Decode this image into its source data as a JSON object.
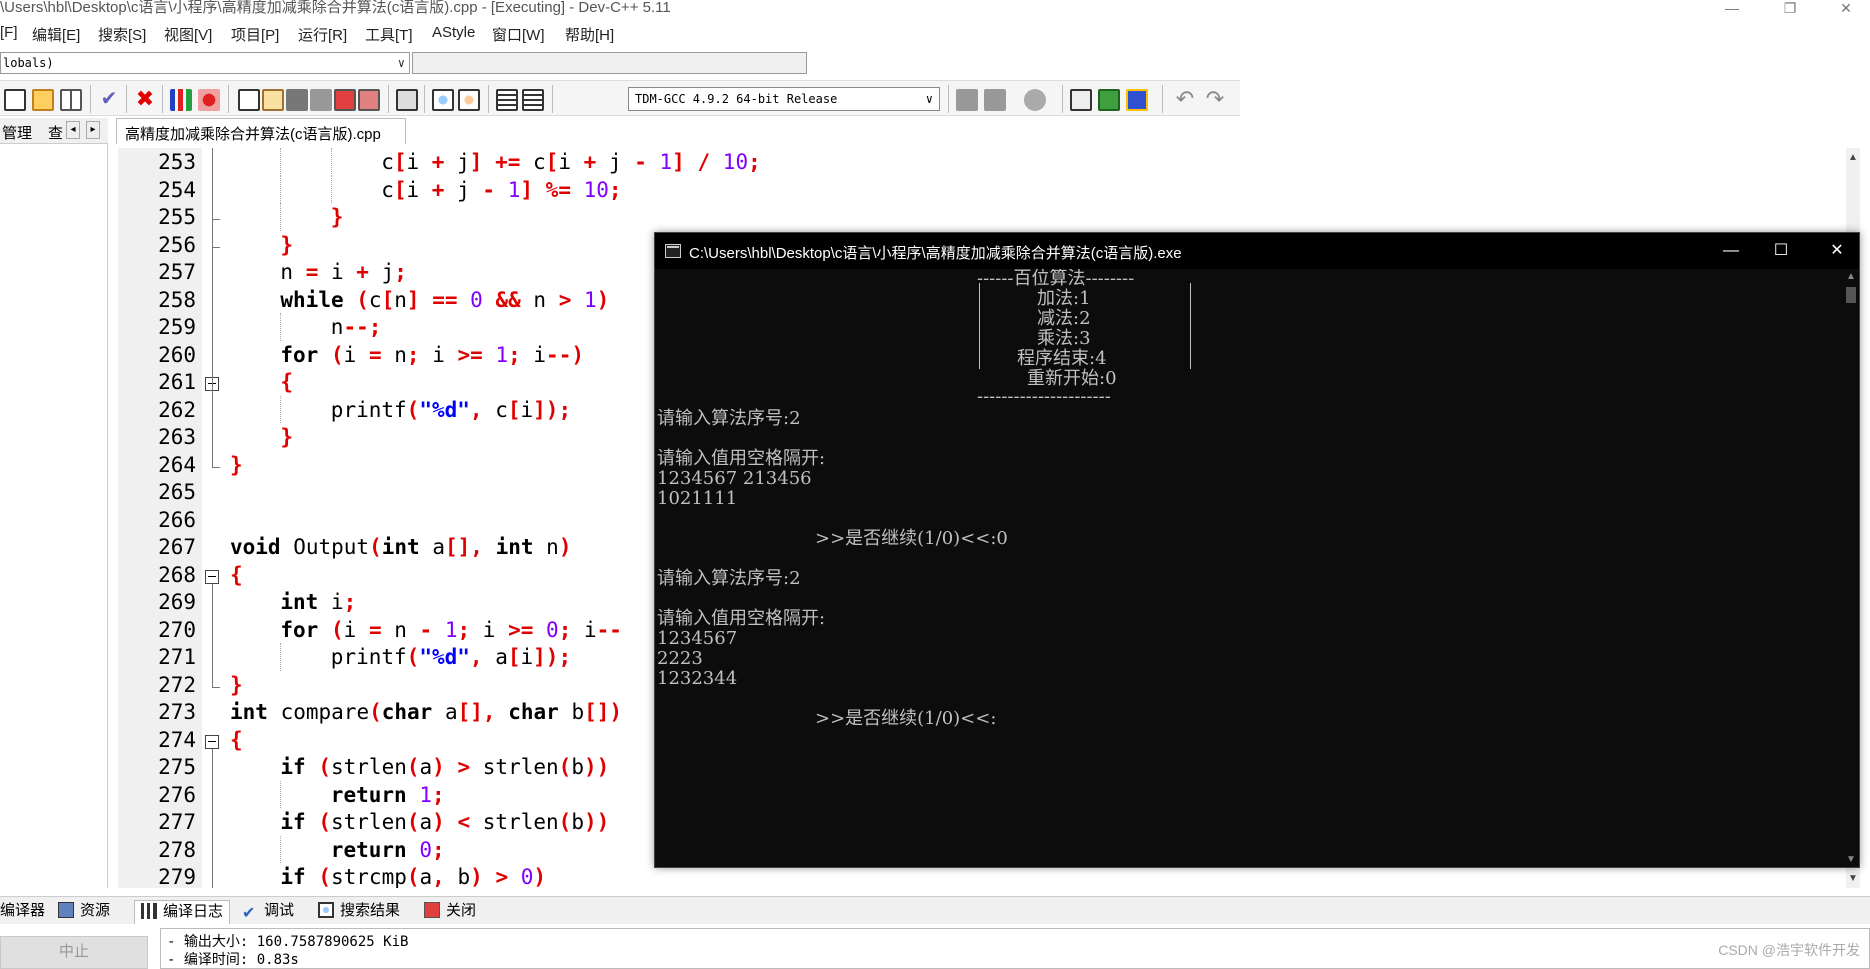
{
  "window": {
    "title": "\\Users\\hbl\\Desktop\\c语言\\小程序\\高精度加减乘除合并算法(c语言版).cpp - [Executing] - Dev-C++ 5.11",
    "minimize": "—",
    "restore": "❐",
    "close": "✕"
  },
  "menu": [
    "[F]",
    "编辑[E]",
    "搜索[S]",
    "视图[V]",
    "项目[P]",
    "运行[R]",
    "工具[T]",
    "AStyle",
    "窗口[W]",
    "帮助[H]"
  ],
  "scope": {
    "value": "lobals)",
    "arrow": "∨"
  },
  "toolbar": {
    "compiler": "TDM-GCC 4.9.2 64-bit Release",
    "arrow": "∨",
    "icons": [
      "new-file-icon",
      "open-file-icon",
      "grid-icon",
      "check-icon",
      "cross-icon",
      "chart-icon",
      "debug-icon",
      "page-icon",
      "edit-icon",
      "save-icon",
      "save-all-icon",
      "close-file-icon",
      "close-all-icon",
      "print-icon",
      "find-icon",
      "replace-icon",
      "indent-icon",
      "unindent-icon",
      "back-icon",
      "forward-icon",
      "bookmark-icon",
      "goto-icon",
      "add-icon",
      "toggle-icon",
      "undo-icon",
      "redo-icon"
    ]
  },
  "left_panel": {
    "tab1": "管理",
    "tab2": "查",
    "prev": "◂",
    "next": "▸"
  },
  "file_tab": "高精度加减乘除合并算法(c语言版).cpp",
  "editor": {
    "lines": [
      {
        "n": "253",
        "indent": 3,
        "code": [
          [
            "t",
            "c"
          ],
          [
            "s",
            "["
          ],
          [
            "t",
            "i "
          ],
          [
            "s",
            "+"
          ],
          [
            "t",
            " j"
          ],
          [
            "s",
            "]"
          ],
          [
            "t",
            " "
          ],
          [
            "s",
            "+="
          ],
          [
            "t",
            " c"
          ],
          [
            "s",
            "["
          ],
          [
            "t",
            "i "
          ],
          [
            "s",
            "+"
          ],
          [
            "t",
            " j "
          ],
          [
            "s",
            "-"
          ],
          [
            "t",
            " "
          ],
          [
            "n",
            "1"
          ],
          [
            "s",
            "]"
          ],
          [
            "t",
            " "
          ],
          [
            "s",
            "/"
          ],
          [
            "t",
            " "
          ],
          [
            "n",
            "10"
          ],
          [
            "s",
            ";"
          ]
        ]
      },
      {
        "n": "254",
        "indent": 3,
        "code": [
          [
            "t",
            "c"
          ],
          [
            "s",
            "["
          ],
          [
            "t",
            "i "
          ],
          [
            "s",
            "+"
          ],
          [
            "t",
            " j "
          ],
          [
            "s",
            "-"
          ],
          [
            "t",
            " "
          ],
          [
            "n",
            "1"
          ],
          [
            "s",
            "]"
          ],
          [
            "t",
            " "
          ],
          [
            "s",
            "%="
          ],
          [
            "t",
            " "
          ],
          [
            "n",
            "10"
          ],
          [
            "s",
            ";"
          ]
        ]
      },
      {
        "n": "255",
        "indent": 2,
        "code": [
          [
            "s",
            "}"
          ]
        ]
      },
      {
        "n": "256",
        "indent": 1,
        "code": [
          [
            "s",
            "}"
          ]
        ]
      },
      {
        "n": "257",
        "indent": 1,
        "code": [
          [
            "t",
            "n "
          ],
          [
            "s",
            "="
          ],
          [
            "t",
            " i "
          ],
          [
            "s",
            "+"
          ],
          [
            "t",
            " j"
          ],
          [
            "s",
            ";"
          ]
        ]
      },
      {
        "n": "258",
        "indent": 1,
        "code": [
          [
            "k",
            "while"
          ],
          [
            "t",
            " "
          ],
          [
            "s",
            "("
          ],
          [
            "t",
            "c"
          ],
          [
            "s",
            "["
          ],
          [
            "t",
            "n"
          ],
          [
            "s",
            "]"
          ],
          [
            "t",
            " "
          ],
          [
            "s",
            "=="
          ],
          [
            "t",
            " "
          ],
          [
            "n",
            "0"
          ],
          [
            "t",
            " "
          ],
          [
            "s",
            "&&"
          ],
          [
            "t",
            " n "
          ],
          [
            "s",
            ">"
          ],
          [
            "t",
            " "
          ],
          [
            "n",
            "1"
          ],
          [
            "s",
            ")"
          ]
        ]
      },
      {
        "n": "259",
        "indent": 2,
        "code": [
          [
            "t",
            "n"
          ],
          [
            "s",
            "--;"
          ]
        ]
      },
      {
        "n": "260",
        "indent": 1,
        "code": [
          [
            "k",
            "for"
          ],
          [
            "t",
            " "
          ],
          [
            "s",
            "("
          ],
          [
            "t",
            "i "
          ],
          [
            "s",
            "="
          ],
          [
            "t",
            " n"
          ],
          [
            "s",
            ";"
          ],
          [
            "t",
            " i "
          ],
          [
            "s",
            ">="
          ],
          [
            "t",
            " "
          ],
          [
            "n",
            "1"
          ],
          [
            "s",
            ";"
          ],
          [
            "t",
            " i"
          ],
          [
            "s",
            "--)"
          ]
        ]
      },
      {
        "n": "261",
        "indent": 1,
        "code": [
          [
            "s",
            "{"
          ]
        ]
      },
      {
        "n": "262",
        "indent": 2,
        "code": [
          [
            "t",
            "printf"
          ],
          [
            "s",
            "("
          ],
          [
            "q",
            "\"%d\""
          ],
          [
            "s",
            ","
          ],
          [
            "t",
            " c"
          ],
          [
            "s",
            "["
          ],
          [
            "t",
            "i"
          ],
          [
            "s",
            "]);"
          ]
        ]
      },
      {
        "n": "263",
        "indent": 1,
        "code": [
          [
            "s",
            "}"
          ]
        ]
      },
      {
        "n": "264",
        "indent": 0,
        "code": [
          [
            "s",
            "}"
          ]
        ]
      },
      {
        "n": "265",
        "indent": 0,
        "code": []
      },
      {
        "n": "266",
        "indent": 0,
        "code": []
      },
      {
        "n": "267",
        "indent": 0,
        "code": [
          [
            "k",
            "void"
          ],
          [
            "t",
            " Output"
          ],
          [
            "s",
            "("
          ],
          [
            "k",
            "int"
          ],
          [
            "t",
            " a"
          ],
          [
            "s",
            "[],"
          ],
          [
            "t",
            " "
          ],
          [
            "k",
            "int"
          ],
          [
            "t",
            " n"
          ],
          [
            "s",
            ")"
          ]
        ]
      },
      {
        "n": "268",
        "indent": 0,
        "code": [
          [
            "s",
            "{"
          ]
        ]
      },
      {
        "n": "269",
        "indent": 1,
        "code": [
          [
            "k",
            "int"
          ],
          [
            "t",
            " i"
          ],
          [
            "s",
            ";"
          ]
        ]
      },
      {
        "n": "270",
        "indent": 1,
        "code": [
          [
            "k",
            "for"
          ],
          [
            "t",
            " "
          ],
          [
            "s",
            "("
          ],
          [
            "t",
            "i "
          ],
          [
            "s",
            "="
          ],
          [
            "t",
            " n "
          ],
          [
            "s",
            "-"
          ],
          [
            "t",
            " "
          ],
          [
            "n",
            "1"
          ],
          [
            "s",
            ";"
          ],
          [
            "t",
            " i "
          ],
          [
            "s",
            ">="
          ],
          [
            "t",
            " "
          ],
          [
            "n",
            "0"
          ],
          [
            "s",
            ";"
          ],
          [
            "t",
            " i"
          ],
          [
            "s",
            "--"
          ]
        ]
      },
      {
        "n": "271",
        "indent": 2,
        "code": [
          [
            "t",
            "printf"
          ],
          [
            "s",
            "("
          ],
          [
            "q",
            "\"%d\""
          ],
          [
            "s",
            ","
          ],
          [
            "t",
            " a"
          ],
          [
            "s",
            "["
          ],
          [
            "t",
            "i"
          ],
          [
            "s",
            "]);"
          ]
        ]
      },
      {
        "n": "272",
        "indent": 0,
        "code": [
          [
            "s",
            "}"
          ]
        ]
      },
      {
        "n": "273",
        "indent": 0,
        "code": [
          [
            "k",
            "int"
          ],
          [
            "t",
            " compare"
          ],
          [
            "s",
            "("
          ],
          [
            "k",
            "char"
          ],
          [
            "t",
            " a"
          ],
          [
            "s",
            "[],"
          ],
          [
            "t",
            " "
          ],
          [
            "k",
            "char"
          ],
          [
            "t",
            " b"
          ],
          [
            "s",
            "[])"
          ]
        ]
      },
      {
        "n": "274",
        "indent": 0,
        "code": [
          [
            "s",
            "{"
          ]
        ]
      },
      {
        "n": "275",
        "indent": 1,
        "code": [
          [
            "k",
            "if"
          ],
          [
            "t",
            " "
          ],
          [
            "s",
            "("
          ],
          [
            "t",
            "strlen"
          ],
          [
            "s",
            "("
          ],
          [
            "t",
            "a"
          ],
          [
            "s",
            ")"
          ],
          [
            "t",
            " "
          ],
          [
            "s",
            ">"
          ],
          [
            "t",
            " strlen"
          ],
          [
            "s",
            "("
          ],
          [
            "t",
            "b"
          ],
          [
            "s",
            "))"
          ]
        ]
      },
      {
        "n": "276",
        "indent": 2,
        "code": [
          [
            "k",
            "return"
          ],
          [
            "t",
            " "
          ],
          [
            "n",
            "1"
          ],
          [
            "s",
            ";"
          ]
        ]
      },
      {
        "n": "277",
        "indent": 1,
        "code": [
          [
            "k",
            "if"
          ],
          [
            "t",
            " "
          ],
          [
            "s",
            "("
          ],
          [
            "t",
            "strlen"
          ],
          [
            "s",
            "("
          ],
          [
            "t",
            "a"
          ],
          [
            "s",
            ")"
          ],
          [
            "t",
            " "
          ],
          [
            "s",
            "<"
          ],
          [
            "t",
            " strlen"
          ],
          [
            "s",
            "("
          ],
          [
            "t",
            "b"
          ],
          [
            "s",
            "))"
          ]
        ]
      },
      {
        "n": "278",
        "indent": 2,
        "code": [
          [
            "k",
            "return"
          ],
          [
            "t",
            " "
          ],
          [
            "n",
            "0"
          ],
          [
            "s",
            ";"
          ]
        ]
      },
      {
        "n": "279",
        "indent": 1,
        "code": [
          [
            "k",
            "if"
          ],
          [
            "t",
            " "
          ],
          [
            "s",
            "("
          ],
          [
            "t",
            "strcmp"
          ],
          [
            "s",
            "("
          ],
          [
            "t",
            "a"
          ],
          [
            "s",
            ","
          ],
          [
            "t",
            " b"
          ],
          [
            "s",
            ")"
          ],
          [
            "t",
            " "
          ],
          [
            "s",
            ">"
          ],
          [
            "t",
            " "
          ],
          [
            "n",
            "0"
          ],
          [
            "s",
            ")"
          ]
        ]
      }
    ]
  },
  "console": {
    "title": "C:\\Users\\hbl\\Desktop\\c语言\\小程序\\高精度加减乘除合并算法(c语言版).exe",
    "min": "—",
    "max": "☐",
    "close": "✕",
    "lines": [
      "------百位算法--------",
      "加法:1",
      "减法:2",
      "乘法:3",
      "程序结束:4",
      "重新开始:0",
      "----------------------",
      "请输入算法序号:2",
      "请输入值用空格隔开:",
      "1234567 213456",
      "1021111",
      ">>是否继续(1/0)<<:0",
      "请输入算法序号:2",
      "请输入值用空格隔开:",
      "1234567",
      "2223",
      "1232344",
      ">>是否继续(1/0)<<:"
    ]
  },
  "bottom_tabs": [
    "编译器",
    "资源",
    "编译日志",
    "调试",
    "搜索结果",
    "关闭"
  ],
  "stop_button": "中止",
  "log": {
    "line1": "- 输出大小: 160.7587890625 KiB",
    "line2": "- 编译时间: 0.83s"
  },
  "watermark": "CSDN @浩宇软件开发"
}
